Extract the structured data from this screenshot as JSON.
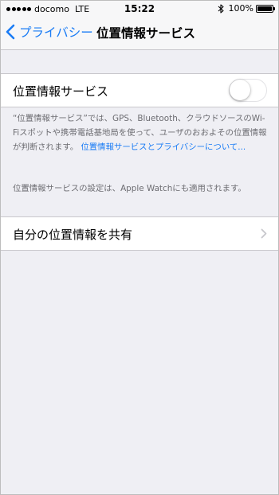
{
  "status_bar": {
    "carrier": "docomo",
    "network": "LTE",
    "time": "15:22",
    "battery": "100%"
  },
  "nav": {
    "back_label": "プライバシー",
    "title": "位置情報サービス"
  },
  "location_services": {
    "label": "位置情報サービス",
    "toggle_on": false
  },
  "footer": {
    "description": "“位置情報サービス”では、GPS、Bluetooth、クラウドソースのWi-Fiスポットや携帯電話基地局を使って、ユーザのおおよその位置情報が判断されます。",
    "link_text": "位置情報サービスとプライバシーについて...",
    "watch_note": "位置情報サービスの設定は、Apple Watchにも適用されます。"
  },
  "share_location": {
    "label": "自分の位置情報を共有"
  },
  "colors": {
    "accent": "#1a7cf5",
    "background": "#efeff4",
    "cell": "#ffffff",
    "separator": "#c8c7cc",
    "footer_text": "#6d6d72"
  },
  "icons": {
    "back": "chevron-left-icon",
    "bluetooth": "bluetooth-icon",
    "battery": "battery-icon",
    "signal": "signal-dots-icon",
    "disclosure": "chevron-right-icon"
  }
}
